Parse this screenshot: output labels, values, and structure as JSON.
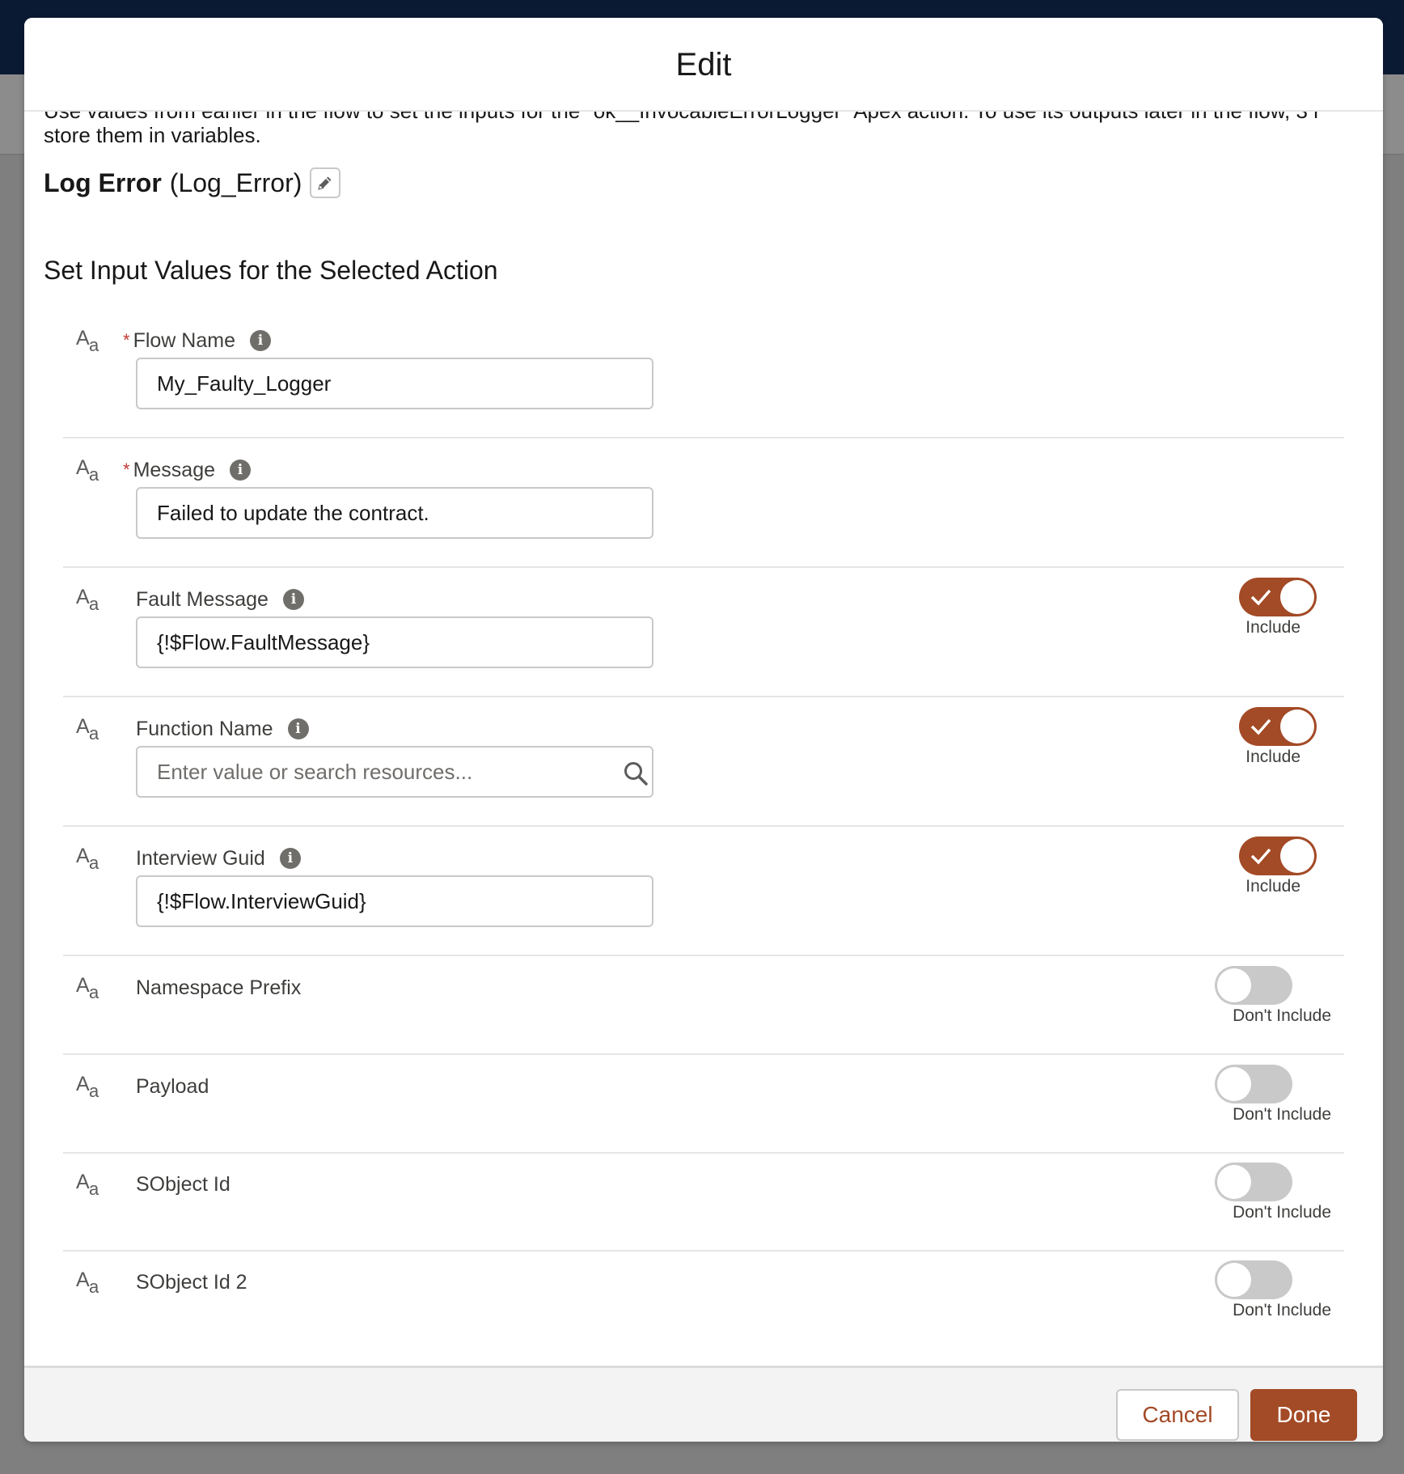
{
  "modal": {
    "title": "Edit"
  },
  "intro": {
    "line1": "Use values from earlier in the flow to set the inputs for the \"ok__InvocableErrorLogger\" Apex action. To use its outputs later in the flow, 3 r",
    "line2": "store them in variables."
  },
  "action": {
    "label": "Log Error",
    "api_name": "(Log_Error)"
  },
  "section": {
    "title": "Set Input Values for the Selected Action"
  },
  "fields": [
    {
      "label": "Flow Name",
      "required": "*",
      "value": "My_Faulty_Logger"
    },
    {
      "label": "Message",
      "required": "*",
      "value": "Failed to update the contract."
    },
    {
      "label": "Fault Message",
      "value": "{!$Flow.FaultMessage}",
      "toggle_label": "Include"
    },
    {
      "label": "Function Name",
      "placeholder": "Enter value or search resources...",
      "toggle_label": "Include"
    },
    {
      "label": "Interview Guid",
      "value": "{!$Flow.InterviewGuid}",
      "toggle_label": "Include"
    },
    {
      "label": "Namespace Prefix",
      "toggle_label": "Don't Include"
    },
    {
      "label": "Payload",
      "toggle_label": "Don't Include"
    },
    {
      "label": "SObject Id",
      "toggle_label": "Don't Include"
    },
    {
      "label": "SObject Id 2",
      "toggle_label": "Don't Include"
    }
  ],
  "footer": {
    "cancel_label": "Cancel",
    "done_label": "Done"
  },
  "colors": {
    "brand": "#a34a26",
    "topbar": "#0b1a33",
    "required": "#c23934"
  }
}
